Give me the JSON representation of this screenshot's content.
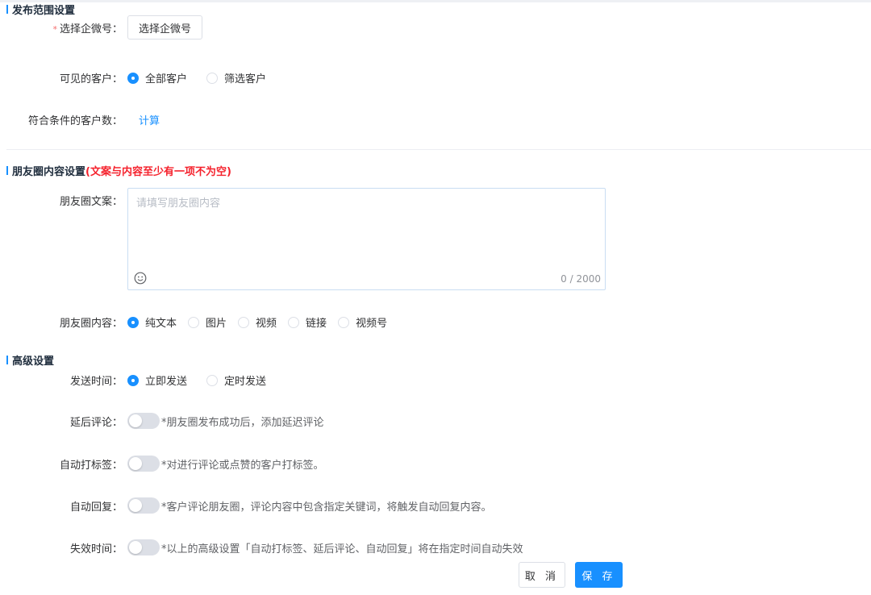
{
  "publish_scope": {
    "title": "发布范围设置",
    "wecom": {
      "required_mark": "*",
      "label": "选择企微号：",
      "button": "选择企微号"
    },
    "visible_customers": {
      "label": "可见的客户：",
      "options": [
        {
          "label": "全部客户",
          "checked": true
        },
        {
          "label": "筛选客户",
          "checked": false
        }
      ]
    },
    "matching_count": {
      "label": "符合条件的客户数：",
      "action": "计算"
    }
  },
  "moments_content": {
    "title": "朋友圈内容设置",
    "warning": "(文案与内容至少有一项不为空)",
    "copy": {
      "label": "朋友圈文案：",
      "placeholder": "请填写朋友圈内容",
      "counter": "0 / 2000",
      "emoji_icon": "smiley-icon"
    },
    "content_type": {
      "label": "朋友圈内容：",
      "options": [
        {
          "label": "纯文本",
          "checked": true
        },
        {
          "label": "图片",
          "checked": false
        },
        {
          "label": "视频",
          "checked": false
        },
        {
          "label": "链接",
          "checked": false
        },
        {
          "label": "视频号",
          "checked": false
        }
      ]
    }
  },
  "advanced": {
    "title": "高级设置",
    "send_time": {
      "label": "发送时间：",
      "options": [
        {
          "label": "立即发送",
          "checked": true
        },
        {
          "label": "定时发送",
          "checked": false
        }
      ]
    },
    "delayed_comment": {
      "label": "延后评论：",
      "enabled": false,
      "hint": "*朋友圈发布成功后，添加延迟评论"
    },
    "auto_tag": {
      "label": "自动打标签：",
      "enabled": false,
      "hint": "*对进行评论或点赞的客户打标签。"
    },
    "auto_reply": {
      "label": "自动回复：",
      "enabled": false,
      "hint": "*客户评论朋友圈，评论内容中包含指定关键词，将触发自动回复内容。"
    },
    "expire_time": {
      "label": "失效时间：",
      "enabled": false,
      "hint": "*以上的高级设置「自动打标签、延后评论、自动回复」将在指定时间自动失效"
    }
  },
  "footer": {
    "cancel": "取 消",
    "save": "保 存"
  },
  "colors": {
    "primary": "#1890ff",
    "warning": "#f5222d",
    "required": "#f56c6c"
  }
}
